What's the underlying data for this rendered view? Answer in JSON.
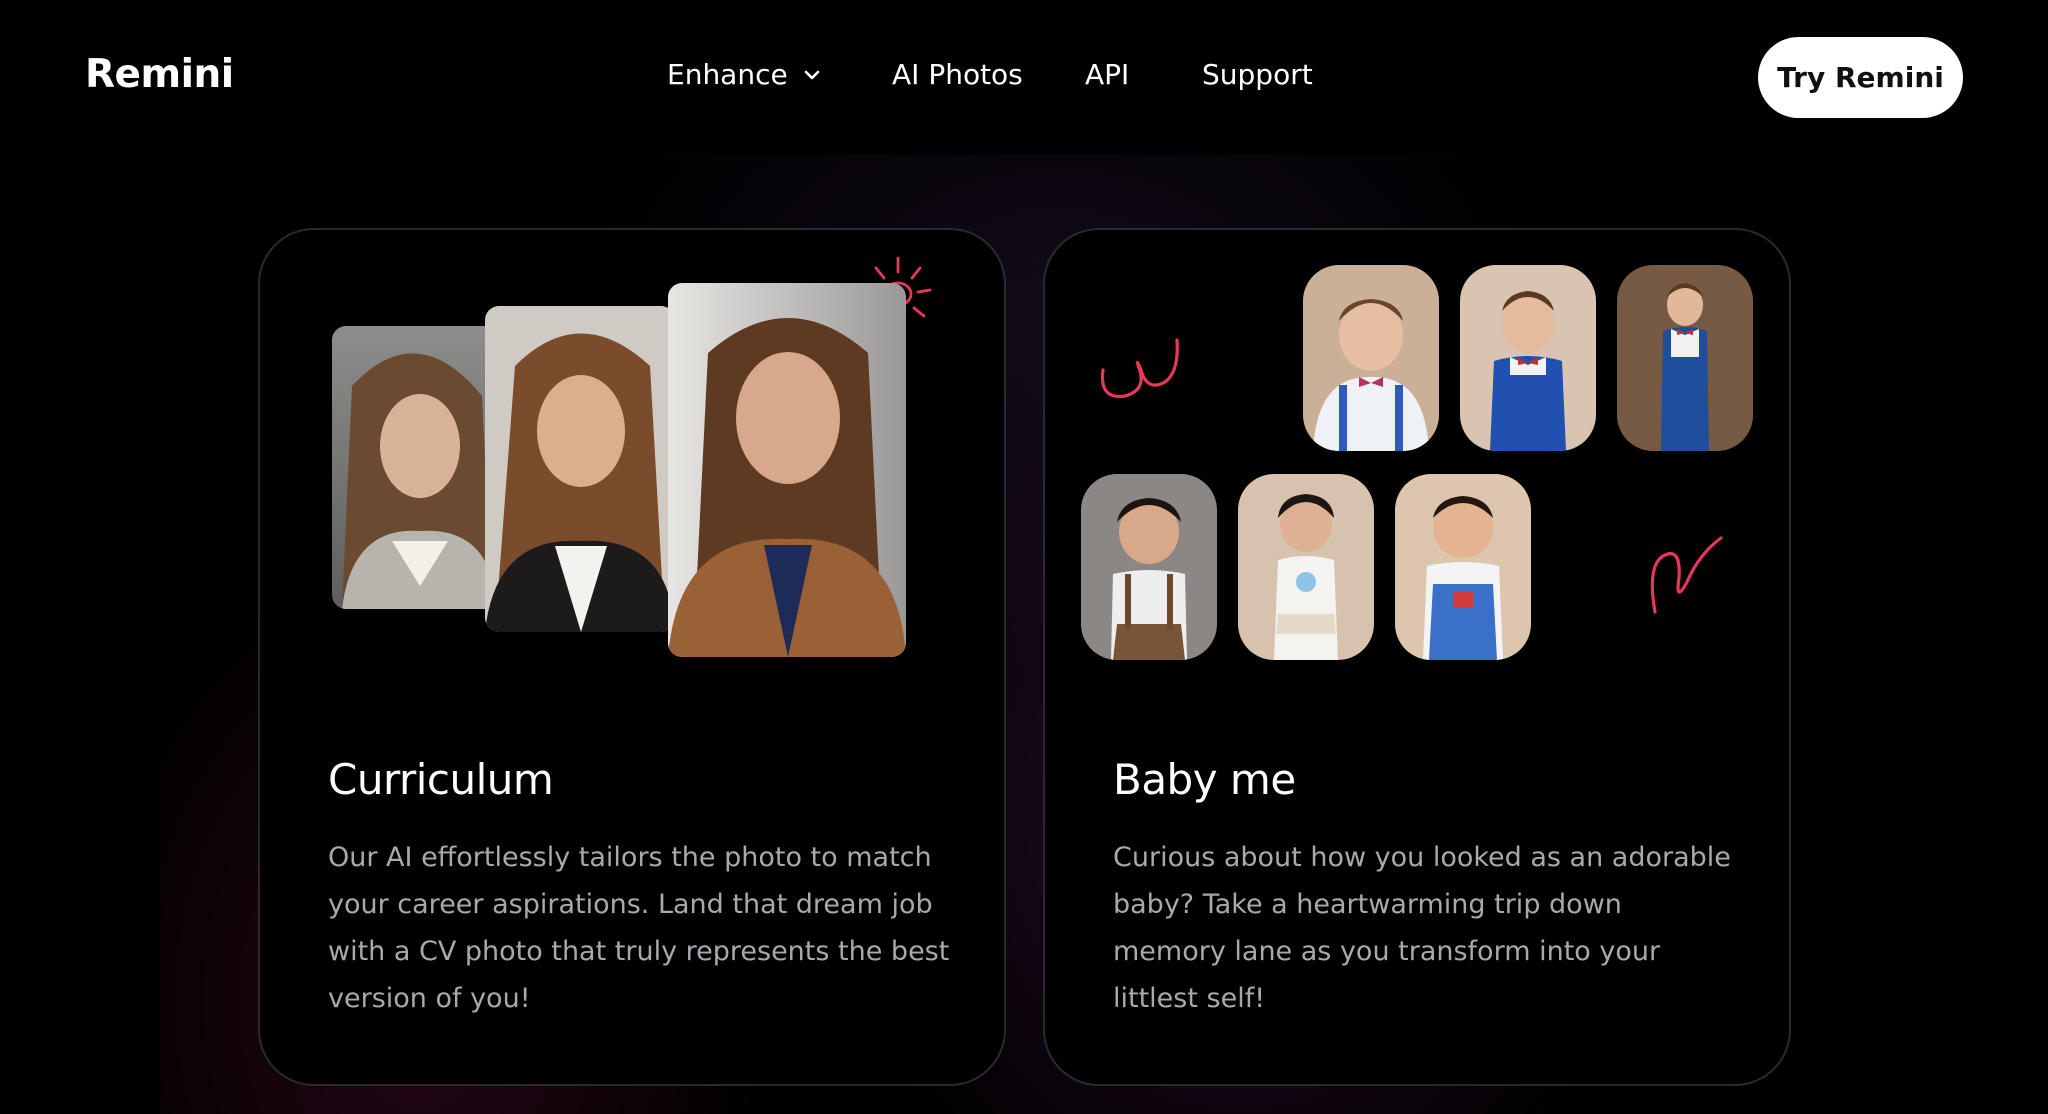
{
  "header": {
    "logo": "Remini",
    "nav": [
      {
        "label": "Enhance",
        "has_dropdown": true
      },
      {
        "label": "AI Photos"
      },
      {
        "label": "API"
      },
      {
        "label": "Support"
      }
    ],
    "cta_label": "Try Remini"
  },
  "cards": [
    {
      "title": "Curriculum",
      "description": "Our AI effortlessly tailors the photo to match your career aspirations. Land that dream job with a CV photo that truly represents the best version of you!"
    },
    {
      "title": "Baby me",
      "description": "Curious about how you looked as an adorable baby? Take a heartwarming trip down memory lane as you transform into your littlest self!"
    }
  ],
  "colors": {
    "background": "#000000",
    "accent_doodle": "#e8375a",
    "desc_text": "#a9a9ad",
    "button_bg": "#ffffff"
  }
}
